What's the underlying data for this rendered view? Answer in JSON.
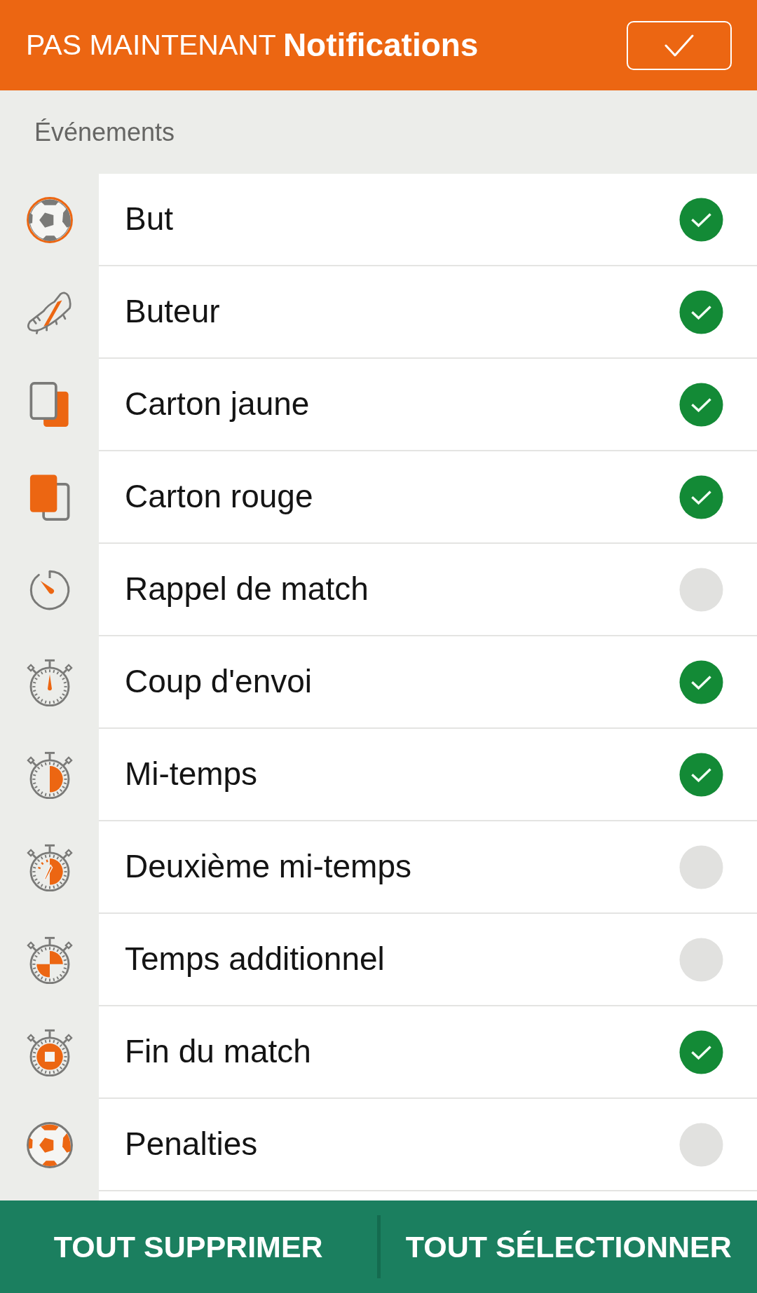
{
  "top_bar": {
    "dismiss_button": "PAS MAINTENANT",
    "title": "Notifications"
  },
  "section": {
    "title": "Événements"
  },
  "events": [
    {
      "kind": "goal",
      "label": "But",
      "checked": true
    },
    {
      "kind": "scorer",
      "label": "Buteur",
      "checked": true
    },
    {
      "kind": "yellow_card",
      "label": "Carton jaune",
      "checked": true
    },
    {
      "kind": "red_card",
      "label": "Carton rouge",
      "checked": true
    },
    {
      "kind": "reminder",
      "label": "Rappel de match",
      "checked": false
    },
    {
      "kind": "kickoff",
      "label": "Coup d'envoi",
      "checked": true
    },
    {
      "kind": "half_time",
      "label": "Mi-temps",
      "checked": true
    },
    {
      "kind": "second_half",
      "label": "Deuxième mi-temps",
      "checked": false
    },
    {
      "kind": "added_time",
      "label": "Temps additionnel",
      "checked": false
    },
    {
      "kind": "full_time",
      "label": "Fin du match",
      "checked": true
    },
    {
      "kind": "penalties",
      "label": "Penalties",
      "checked": false
    }
  ],
  "bottom_bar": {
    "buttons": [
      "TOUT SUPPRIMER",
      "TOUT SÉLECTIONNER"
    ]
  }
}
